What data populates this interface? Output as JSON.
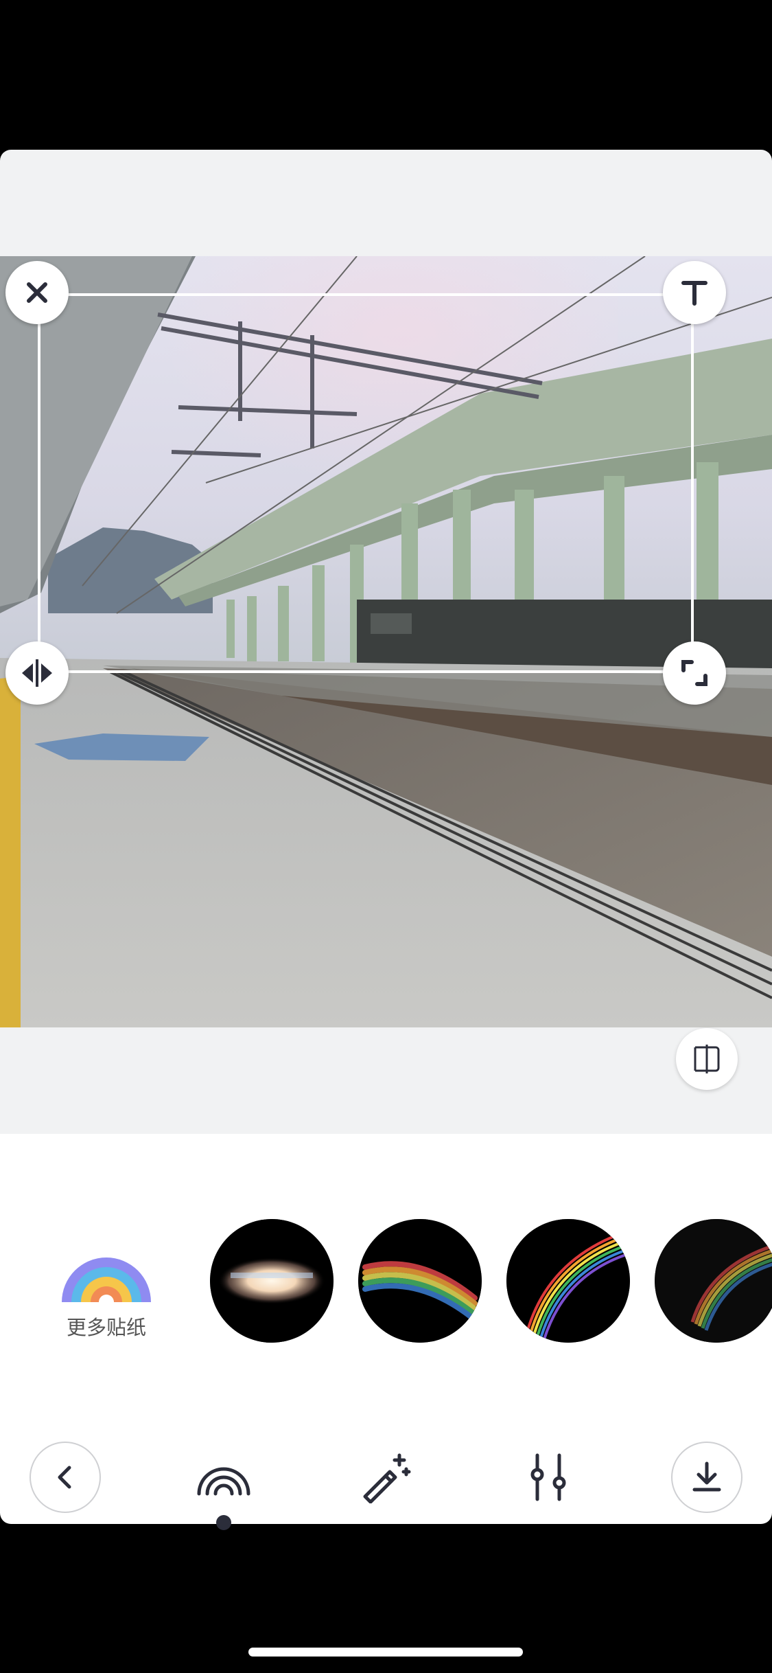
{
  "more_stickers": {
    "label": "更多贴纸",
    "icon": "rainbow-icon"
  },
  "stickers": [
    {
      "name": "light-bar"
    },
    {
      "name": "soft-rainbow-streak"
    },
    {
      "name": "rainbow-arc"
    },
    {
      "name": "faint-rainbow-arc"
    }
  ],
  "handles": {
    "close_icon": "close-icon",
    "text_icon": "text-icon",
    "text_glyph": "T",
    "flip_icon": "flip-horizontal-icon",
    "resize_icon": "resize-icon"
  },
  "toolbar": {
    "back_icon": "chevron-left-icon",
    "tabs": [
      {
        "name": "rainbow-sticker",
        "icon": "rainbow-outline-icon",
        "active": true
      },
      {
        "name": "magic",
        "icon": "magic-wand-icon",
        "active": false
      },
      {
        "name": "adjust",
        "icon": "sliders-icon",
        "active": false
      }
    ],
    "download_icon": "download-icon"
  },
  "colors": {
    "canvas_bg": "#f1f2f3",
    "panel_bg": "#ffffff",
    "icon_dark": "#2b2d3a",
    "label_gray": "#555555"
  }
}
